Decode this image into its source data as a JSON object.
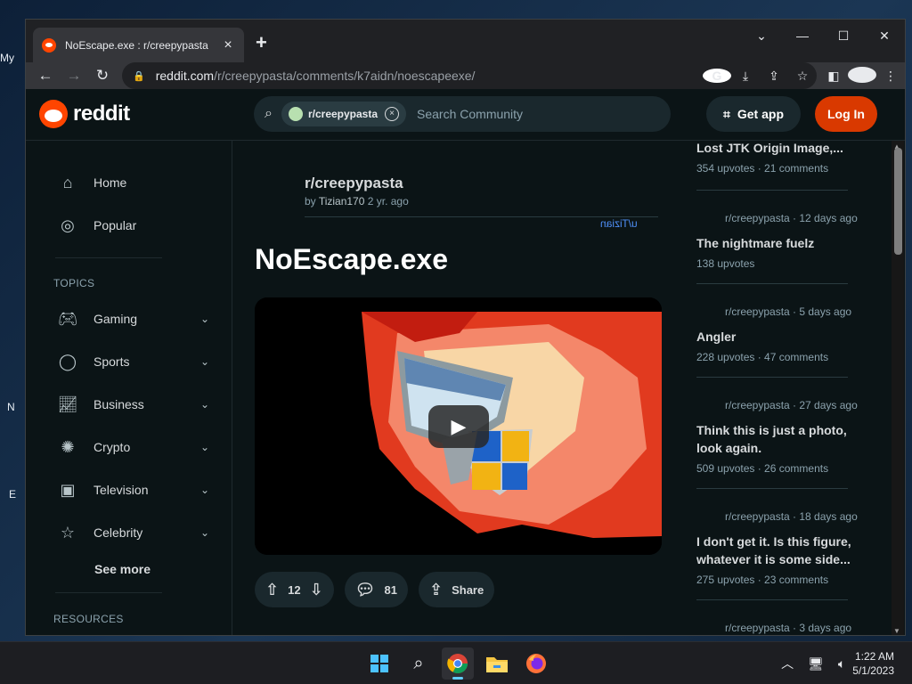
{
  "browser": {
    "tab_title": "NoEscape.exe : r/creepypasta",
    "url_domain": "reddit.com",
    "url_path": "/r/creepypasta/comments/k7aidn/noescapeexe/",
    "new_tab": "+",
    "minimize": "—",
    "maximize": "☐",
    "close": "✕",
    "tab_list": "⌄"
  },
  "header": {
    "logo_text": "reddit",
    "community_chip": "r/creepypasta",
    "search_placeholder": "Search Community",
    "get_app_label": "Get app",
    "login_label": "Log In"
  },
  "sidebar": {
    "home": "Home",
    "popular": "Popular",
    "topics_heading": "TOPICS",
    "topics": [
      {
        "label": "Gaming"
      },
      {
        "label": "Sports"
      },
      {
        "label": "Business"
      },
      {
        "label": "Crypto"
      },
      {
        "label": "Television"
      },
      {
        "label": "Celebrity"
      }
    ],
    "see_more": "See more",
    "resources_heading": "RESOURCES"
  },
  "post": {
    "subreddit": "r/creepypasta",
    "by": "by",
    "author": "Tizian170",
    "age": "2 yr. ago",
    "flair": "u/Tizian",
    "title": "NoEscape.exe",
    "upvotes": "12",
    "comments": "81",
    "share_label": "Share"
  },
  "rail": {
    "items": [
      {
        "meta": "",
        "title": "Lost JTK Origin Image,...",
        "stats": "354 upvotes · 21 comments"
      },
      {
        "meta": "r/creepypasta · 12 days ago",
        "title": "The nightmare fuelz",
        "stats": "138 upvotes"
      },
      {
        "meta": "r/creepypasta · 5 days ago",
        "title": "Angler",
        "stats": "228 upvotes · 47 comments"
      },
      {
        "meta": "r/creepypasta · 27 days ago",
        "title": "Think this is just a photo, look again.",
        "stats": "509 upvotes · 26 comments"
      },
      {
        "meta": "r/creepypasta · 18 days ago",
        "title": "I don't get it. Is this figure, whatever it is some side...",
        "stats": "275 upvotes · 23 comments"
      },
      {
        "meta": "r/creepypasta · 3 days ago",
        "title": "",
        "stats": ""
      }
    ]
  },
  "taskbar": {
    "time": "1:22 AM",
    "date": "5/1/2023"
  },
  "desktop": {
    "frag1": "My",
    "frag2": "N",
    "frag3": "E"
  }
}
